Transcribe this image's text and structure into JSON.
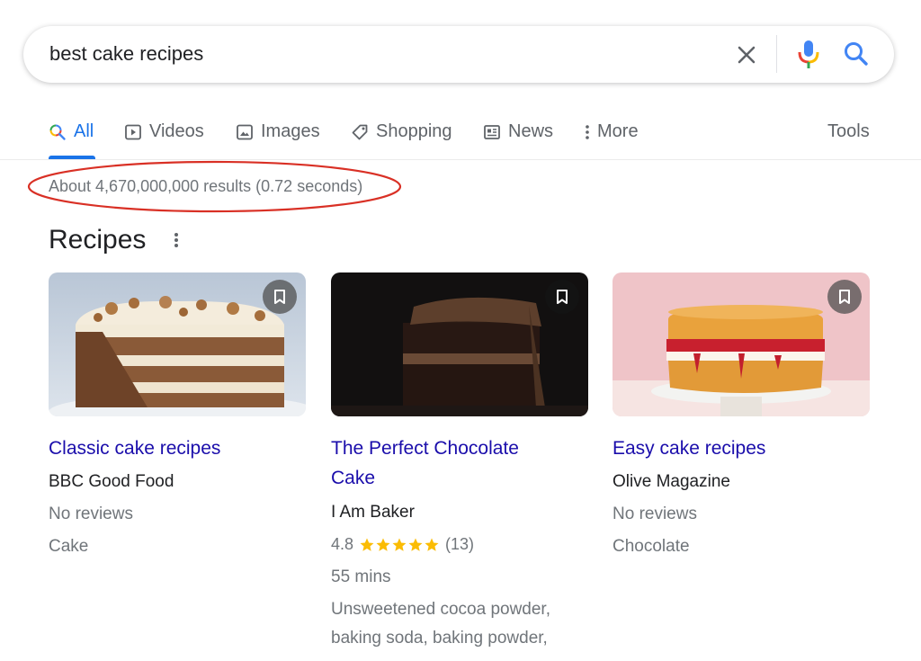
{
  "search": {
    "query": "best cake recipes"
  },
  "tabs": [
    {
      "label": "All",
      "active": true
    },
    {
      "label": "Videos"
    },
    {
      "label": "Images"
    },
    {
      "label": "Shopping"
    },
    {
      "label": "News"
    },
    {
      "label": "More"
    }
  ],
  "tools_label": "Tools",
  "results_stats": "About 4,670,000,000 results (0.72 seconds)",
  "annotation_color": "#d93025",
  "section": {
    "title": "Recipes"
  },
  "recipes": [
    {
      "title": "Classic cake recipes",
      "source": "BBC Good Food",
      "reviews": "No reviews",
      "category": "Cake"
    },
    {
      "title_line1": "The Perfect Chocolate",
      "title_line2": "Cake",
      "source": "I Am Baker",
      "rating": "4.8",
      "stars": 5,
      "rating_count": "(13)",
      "time": "55 mins",
      "ingredients_line1": "Unsweetened cocoa powder,",
      "ingredients_line2": "baking soda, baking powder,"
    },
    {
      "title": "Easy cake recipes",
      "source": "Olive Magazine",
      "reviews": "No reviews",
      "category": "Chocolate"
    }
  ],
  "colors": {
    "link": "#1a0dab",
    "accent": "#1a73e8",
    "star": "#fbbc04",
    "muted": "#70757a"
  }
}
